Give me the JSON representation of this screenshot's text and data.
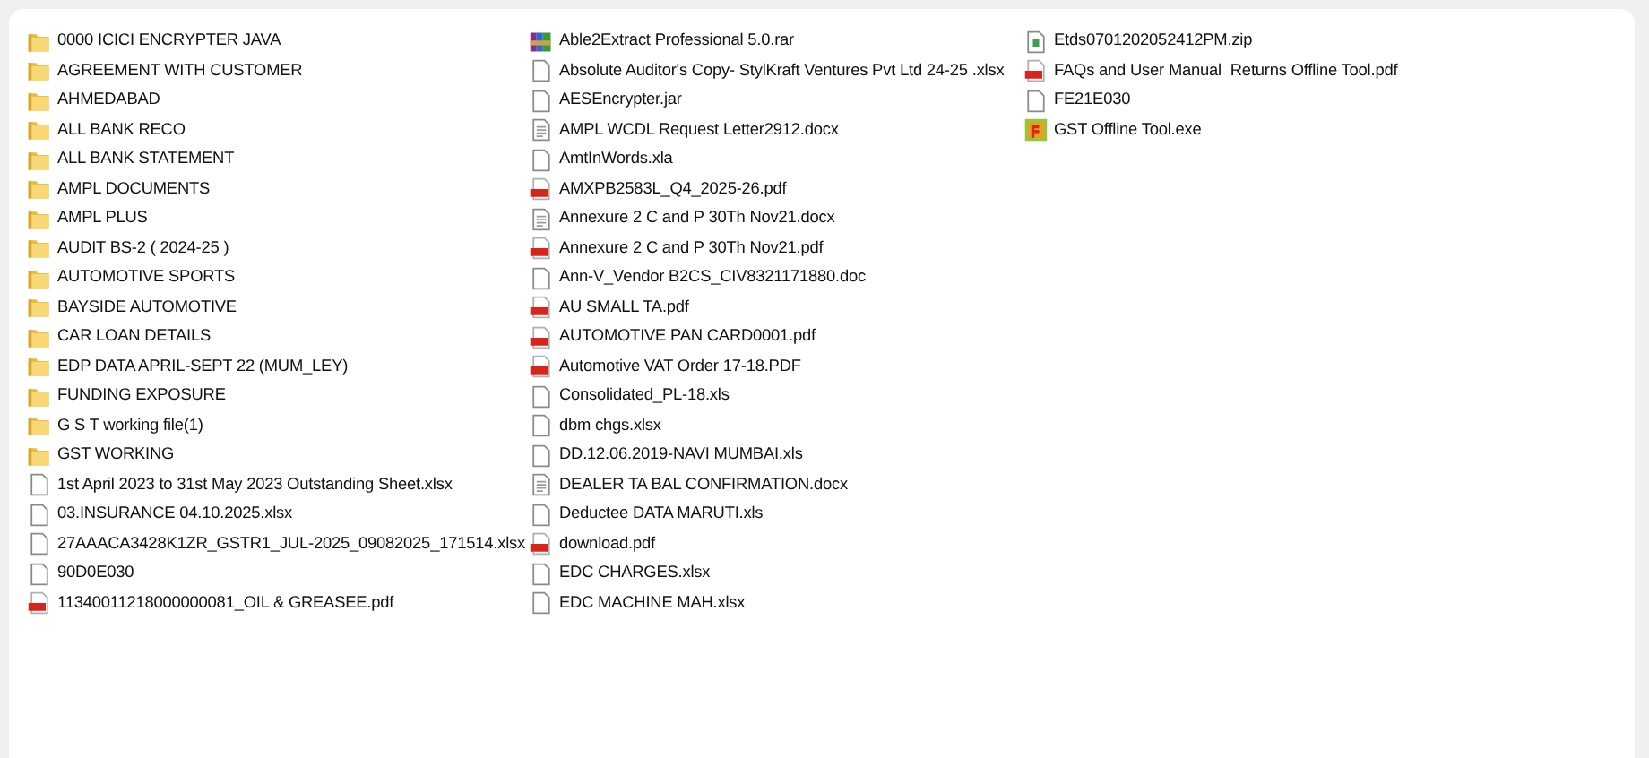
{
  "items": [
    {
      "name": "0000 ICICI ENCRYPTER JAVA",
      "kind": "folder"
    },
    {
      "name": "AGREEMENT WITH CUSTOMER",
      "kind": "folder"
    },
    {
      "name": "AHMEDABAD",
      "kind": "folder"
    },
    {
      "name": "ALL BANK RECO",
      "kind": "folder"
    },
    {
      "name": "ALL BANK STATEMENT",
      "kind": "folder"
    },
    {
      "name": "AMPL DOCUMENTS",
      "kind": "folder"
    },
    {
      "name": "AMPL PLUS",
      "kind": "folder"
    },
    {
      "name": "AUDIT BS-2 ( 2024-25 )",
      "kind": "folder"
    },
    {
      "name": "AUTOMOTIVE SPORTS",
      "kind": "folder"
    },
    {
      "name": "BAYSIDE AUTOMOTIVE",
      "kind": "folder"
    },
    {
      "name": "CAR LOAN DETAILS",
      "kind": "folder"
    },
    {
      "name": "EDP DATA APRIL-SEPT 22 (MUM_LEY)",
      "kind": "folder"
    },
    {
      "name": "FUNDING EXPOSURE",
      "kind": "folder"
    },
    {
      "name": "G S T working file(1)",
      "kind": "folder"
    },
    {
      "name": "GST WORKING",
      "kind": "folder"
    },
    {
      "name": "1st April 2023 to 31st May 2023 Outstanding Sheet.xlsx",
      "kind": "file"
    },
    {
      "name": "03.INSURANCE 04.10.2025.xlsx",
      "kind": "file"
    },
    {
      "name": "27AAACA3428K1ZR_GSTR1_JUL-2025_09082025_171514.xlsx",
      "kind": "file"
    },
    {
      "name": "90D0E030",
      "kind": "file"
    },
    {
      "name": "11340011218000000081_OIL & GREASEE.pdf",
      "kind": "pdf"
    },
    {
      "name": "Able2Extract Professional 5.0.rar",
      "kind": "archive"
    },
    {
      "name": "Absolute Auditor's Copy- StylKraft Ventures Pvt Ltd 24-25 .xlsx",
      "kind": "file"
    },
    {
      "name": "AESEncrypter.jar",
      "kind": "file"
    },
    {
      "name": "AMPL WCDL Request Letter2912.docx",
      "kind": "document"
    },
    {
      "name": "AmtInWords.xla",
      "kind": "file"
    },
    {
      "name": "AMXPB2583L_Q4_2025-26.pdf",
      "kind": "pdf"
    },
    {
      "name": "Annexure 2 C and P 30Th Nov21.docx",
      "kind": "document"
    },
    {
      "name": "Annexure 2 C and P 30Th Nov21.pdf",
      "kind": "pdf"
    },
    {
      "name": "Ann-V_Vendor B2CS_CIV8321171880.doc",
      "kind": "file"
    },
    {
      "name": "AU SMALL TA.pdf",
      "kind": "pdf"
    },
    {
      "name": "AUTOMOTIVE PAN CARD0001.pdf",
      "kind": "pdf"
    },
    {
      "name": "Automotive VAT Order 17-18.PDF",
      "kind": "pdf"
    },
    {
      "name": "Consolidated_PL-18.xls",
      "kind": "file"
    },
    {
      "name": "dbm chgs.xlsx",
      "kind": "file"
    },
    {
      "name": "DD.12.06.2019-NAVI MUMBAI.xls",
      "kind": "file"
    },
    {
      "name": "DEALER TA BAL CONFIRMATION.docx",
      "kind": "document"
    },
    {
      "name": "Deductee DATA MARUTI.xls",
      "kind": "file"
    },
    {
      "name": "download.pdf",
      "kind": "pdf"
    },
    {
      "name": "EDC CHARGES.xlsx",
      "kind": "file"
    },
    {
      "name": "EDC MACHINE MAH.xlsx",
      "kind": "file"
    },
    {
      "name": "Etds0701202052412PM.zip",
      "kind": "zip"
    },
    {
      "name": "FAQs and User Manual  Returns Offline Tool.pdf",
      "kind": "pdf"
    },
    {
      "name": "FE21E030",
      "kind": "file"
    },
    {
      "name": "GST Offline Tool.exe",
      "kind": "program"
    }
  ]
}
